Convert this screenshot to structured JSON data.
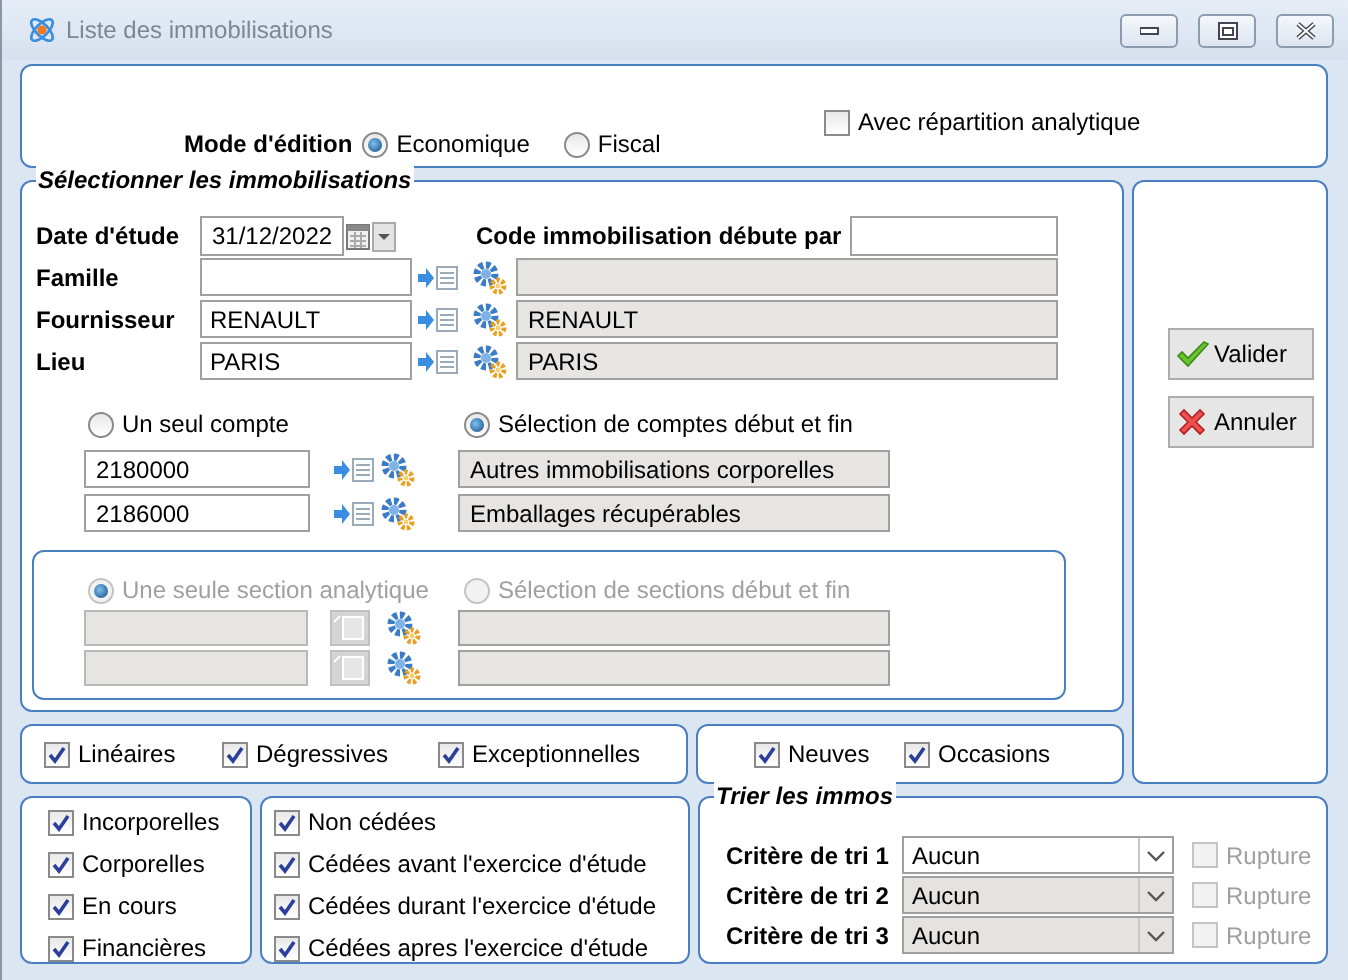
{
  "window": {
    "title": "Liste des immobilisations"
  },
  "edit_mode": {
    "label": "Mode d'édition",
    "options": [
      {
        "label": "Economique",
        "selected": true
      },
      {
        "label": "Fiscal",
        "selected": false
      }
    ]
  },
  "analytic_split": {
    "label": "Avec répartition analytique",
    "checked": false
  },
  "selection": {
    "title": "Sélectionner les immobilisations",
    "date": {
      "label": "Date d'étude",
      "value": "31/12/2022"
    },
    "code": {
      "label": "Code immobilisation débute par"
    },
    "lookups": [
      {
        "label": "Famille"
      },
      {
        "label": "Fournisseur",
        "value": "RENAULT",
        "description": "RENAULT"
      },
      {
        "label": "Lieu",
        "value": "PARIS",
        "description": "PARIS"
      }
    ],
    "account_modes": [
      {
        "label": "Un seul compte",
        "selected": false
      },
      {
        "label": "Sélection de comptes début et fin",
        "selected": true
      }
    ],
    "accounts": [
      {
        "value": "2180000",
        "description": "Autres immobilisations corporelles"
      },
      {
        "value": "2186000",
        "description": "Emballages récupérables"
      }
    ],
    "analytic": {
      "disabled": true,
      "modes": [
        {
          "label": "Une seule section analytique",
          "selected": true
        },
        {
          "label": "Sélection de sections début et fin",
          "selected": false
        }
      ]
    }
  },
  "methods": [
    {
      "label": "Linéaires",
      "checked": true
    },
    {
      "label": "Dégressives",
      "checked": true
    },
    {
      "label": "Exceptionnelles",
      "checked": true
    }
  ],
  "conditions": [
    {
      "label": "Neuves",
      "checked": true
    },
    {
      "label": "Occasions",
      "checked": true
    }
  ],
  "categories": [
    {
      "label": "Incorporelles",
      "checked": true
    },
    {
      "label": "Corporelles",
      "checked": true
    },
    {
      "label": "En cours",
      "checked": true
    },
    {
      "label": "Financières",
      "checked": true
    }
  ],
  "disposals": [
    {
      "label": "Non cédées",
      "checked": true
    },
    {
      "label": "Cédées avant l'exercice d'étude",
      "checked": true
    },
    {
      "label": "Cédées durant l'exercice d'étude",
      "checked": true
    },
    {
      "label": "Cédées apres l'exercice d'étude",
      "checked": true
    }
  ],
  "sort": {
    "title": "Trier les immos",
    "criteria": [
      {
        "label": "Critère de tri 1",
        "value": "Aucun",
        "disabled": false,
        "break_label": "Rupture",
        "break_checked": false,
        "break_disabled": true
      },
      {
        "label": "Critère de tri 2",
        "value": "Aucun",
        "disabled": true,
        "break_label": "Rupture",
        "break_checked": false,
        "break_disabled": true
      },
      {
        "label": "Critère de tri 3",
        "value": "Aucun",
        "disabled": true,
        "break_label": "Rupture",
        "break_checked": false,
        "break_disabled": true
      }
    ]
  },
  "buttons": [
    {
      "label": "Valider",
      "kind": "ok"
    },
    {
      "label": "Annuler",
      "kind": "cancel"
    }
  ]
}
